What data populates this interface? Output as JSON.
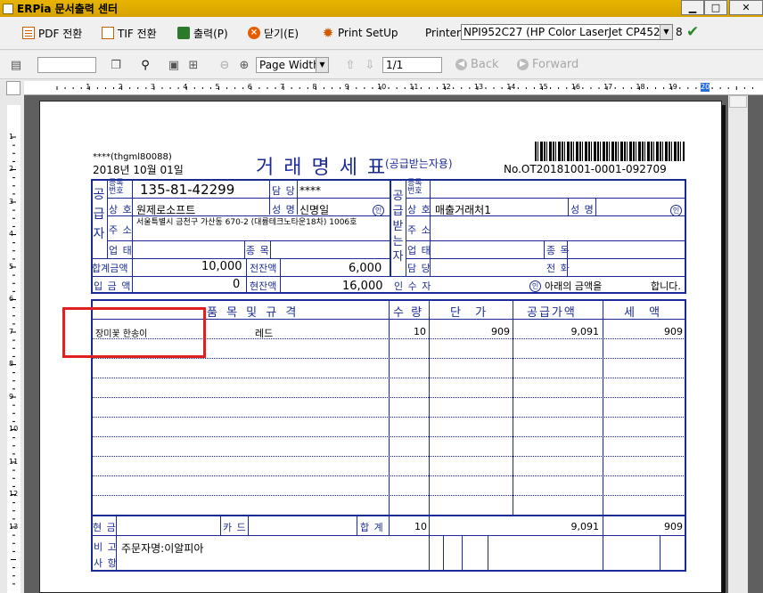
{
  "window": {
    "title": "ERPia 문서출력 센터",
    "buttons": {
      "minimize": "▁",
      "maximize": "□",
      "close": "✕"
    }
  },
  "toolbar1": {
    "pdf_label": "PDF 전환",
    "tif_label": "TIF 전환",
    "print_label": "출력(P)",
    "close_label": "닫기(E)",
    "setup_label": "Print SetUp",
    "printer_label": "Printer",
    "printer_value": "NPI952C27 (HP Color LaserJet CP4520",
    "copies": "8"
  },
  "toolbar2": {
    "zoom_value": "Page Width",
    "page_value": "1/1",
    "back_label": "Back",
    "forward_label": "Forward"
  },
  "ruler": {
    "h_labels": [
      "1",
      "2",
      "3",
      "4",
      "5",
      "6",
      "7",
      "8",
      "9",
      "10",
      "11",
      "12",
      "13",
      "14",
      "15",
      "16",
      "17",
      "18",
      "19",
      "20"
    ],
    "v_labels": [
      "1",
      "2",
      "3",
      "4",
      "5",
      "6",
      "7",
      "8",
      "9",
      "10",
      "11",
      "12",
      "13"
    ]
  },
  "doc": {
    "user": "****(thgml80088)",
    "date": "2018년 10월 01일",
    "title": "거 래 명 세 표",
    "subtitle": "(공급받는자용)",
    "doc_no": "No.OT20181001-0001-092709",
    "supplier": {
      "section": "공급자",
      "reg_no_label": "등록번호",
      "reg_no": "135-81-42299",
      "manager_label": "담 당",
      "manager": "****",
      "company_label": "상 호",
      "company": "원제로소프트",
      "name_label": "성 명",
      "name": "신명일",
      "stamp": "인",
      "address_label": "주 소",
      "address": "서울특별시 금천구 가산동 670-2 (대륭테크노타운18차) 1006호",
      "biz_type_label": "업 태",
      "biz_item_label": "종 목"
    },
    "receiver": {
      "section": "공급받는자",
      "reg_no_label": "등록번호",
      "company_label": "상 호",
      "company": "매출거래처1",
      "name_label": "성 명",
      "stamp": "인",
      "address_label": "주 소",
      "biz_type_label": "업 태",
      "biz_item_label": "종 목",
      "manager_label": "담 당",
      "phone_label": "전 화"
    },
    "totals": {
      "total_label": "합계금액",
      "total": "10,000",
      "prev_balance_label": "전잔액",
      "prev_balance": "6,000",
      "deposit_label": "입 금 액",
      "deposit": "0",
      "curr_balance_label": "현잔액",
      "curr_balance": "16,000",
      "receiver_label": "인 수 자",
      "receipt_text": "아래의 금액을",
      "receipt_end": "합니다."
    },
    "items_header": {
      "name": "품 목 및 규 격",
      "qty": "수 량",
      "price": "단 가",
      "supply": "공급가액",
      "tax": "세 액"
    },
    "items": [
      {
        "name": "장미꽃 한송이",
        "spec": "레드",
        "qty": "10",
        "price": "909",
        "supply": "9,091",
        "tax": "909"
      }
    ],
    "footer": {
      "cash_label": "현 금",
      "card_label": "카 드",
      "sum_label": "합 계",
      "sum_qty": "10",
      "sum_supply": "9,091",
      "sum_tax": "909",
      "remark_label_1": "비 고",
      "remark_label_2": "사 항",
      "remark": "주문자명:이알피아"
    }
  },
  "colors": {
    "doc_line": "#1b2b96",
    "titlebar": "#e0aa00",
    "highlight": "#e02020"
  }
}
